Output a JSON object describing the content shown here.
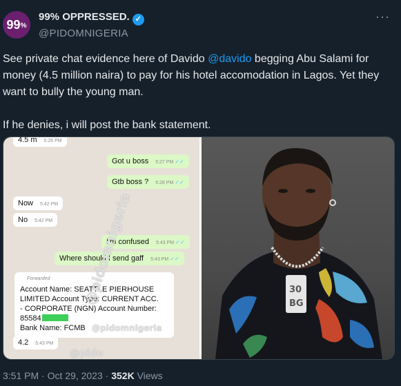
{
  "header": {
    "avatar_text": "99",
    "avatar_sup": "%",
    "display_name": "99% OPPRESSED.",
    "handle": "@PIDOMNIGERIA",
    "more": "···"
  },
  "tweet": {
    "para1_part1": "See private chat evidence here of Davido ",
    "mention": "@davido",
    "para1_part2": " begging Abu Salami for money (4.5 million naira) to pay for his hotel accomodation in Lagos. Yet they want to bully the young man.",
    "para2": "If he denies, i will post the bank statement."
  },
  "chat": {
    "top_partial": "4.5 m",
    "top_partial_time": "5:26 PM",
    "messages": [
      {
        "text": "Got u boss",
        "time": "5:27 PM"
      },
      {
        "text": "Gtb boss ?",
        "time": "5:28 PM"
      },
      {
        "text": "Now",
        "time": "5:42 PM"
      },
      {
        "text": "No",
        "time": "5:42 PM"
      },
      {
        "text": "I'm confused",
        "time": "5:43 PM"
      },
      {
        "text": "Where should I send gaff",
        "time": "5:43 PM"
      },
      {
        "text": "4.2",
        "time": "5:43 PM"
      }
    ],
    "forwarded": "Forwarded",
    "account_line1": "Account Name: SEATTLE PIERHOUSE",
    "account_line2": "LIMITED Account Type: CURRENT ACC.",
    "account_line3": "- CORPORATE (NGN) Account Number:",
    "account_line4": "85584",
    "account_line5": "Bank Name: FCMB",
    "watermark": "@pidomnigeria",
    "watermark_short": "@pido"
  },
  "footer": {
    "time": "3:51 PM",
    "sep": " · ",
    "date": "Oct 29, 2023",
    "sep2": " · ",
    "views_count": "352K",
    "views_label": " Views"
  }
}
